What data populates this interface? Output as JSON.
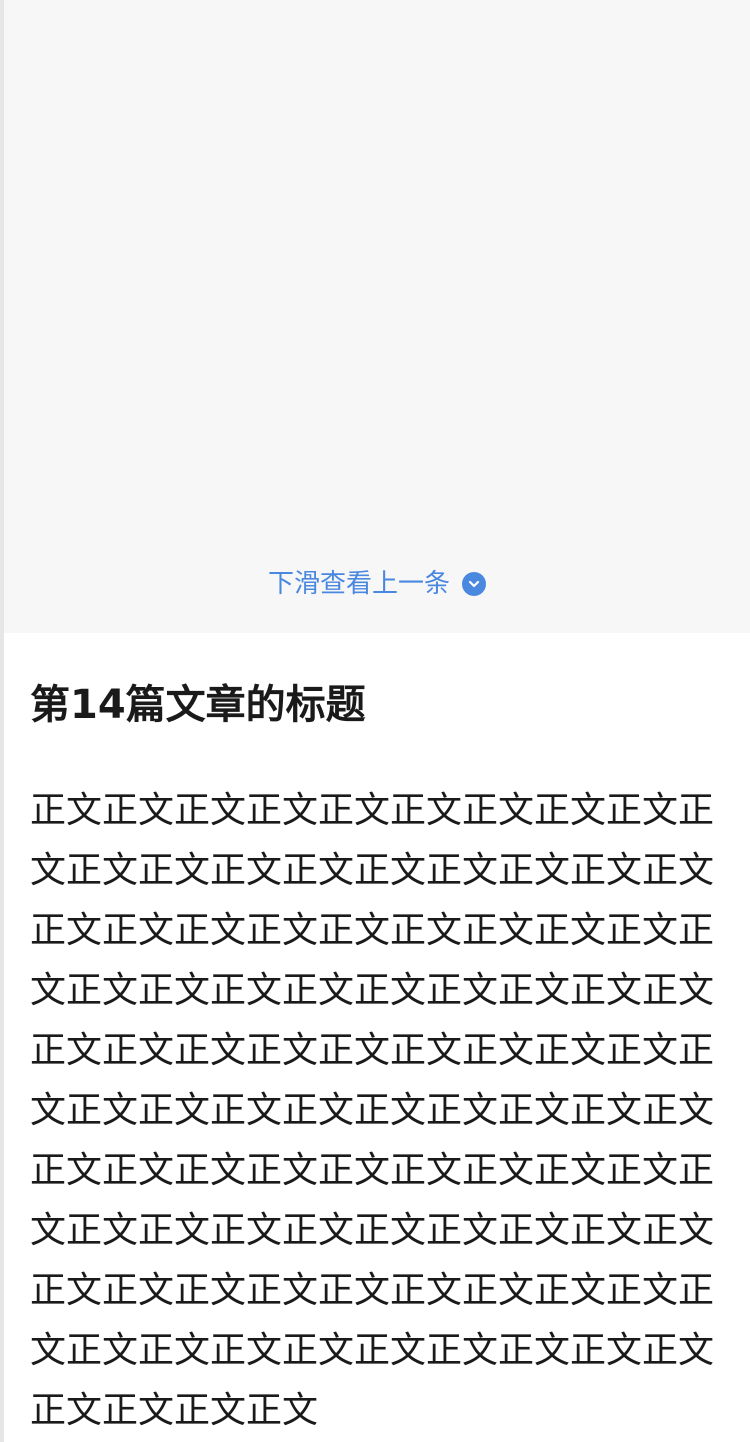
{
  "pull_hint": {
    "label": "下滑查看上一条",
    "icon": "chevron-down-circle-icon",
    "color": "#4a88e0"
  },
  "article": {
    "title": "第14篇文章的标题",
    "body": "正文正文正文正文正文正文正文正文正文正文正文正文正文正文正文正文正文正文正文正文正文正文正文正文正文正文正文正文正文正文正文正文正文正文正文正文正文正文正文正文正文正文正文正文正文正文正文正文正文正文正文正文正文正文正文正文正文正文正文正文正文正文正文正文正文正文正文正文正文正文正文正文正文正文正文正文正文正文正文正文正文正文正文正文正文正文正文正文正文正文正文正文正文正文正文正文正文正文正文"
  }
}
